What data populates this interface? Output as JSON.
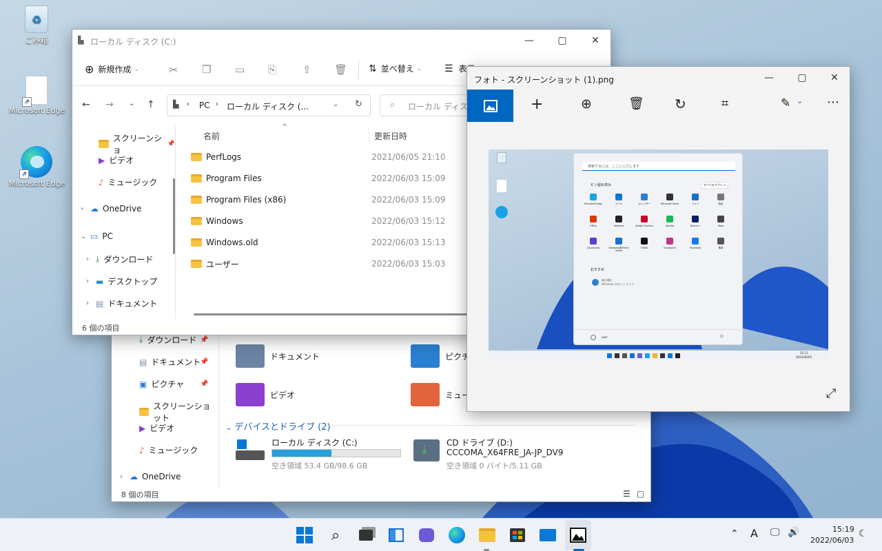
{
  "desktop": {
    "icons": [
      {
        "label": "ごみ箱"
      },
      {
        "label": "Microsoft Edge"
      },
      {
        "label": "Microsoft Edge"
      }
    ]
  },
  "back_explorer": {
    "sidebar": [
      "ダウンロード",
      "ドキュメント",
      "ピクチャ",
      "スクリーンショット",
      "ビデオ",
      "ミュージック",
      "OneDrive"
    ],
    "folders": [
      "ドキュメント",
      "ピクチャ",
      "ビデオ",
      "ミュー"
    ],
    "section_title": "デバイスとドライブ (2)",
    "drives": [
      {
        "name": "ローカル ディスク (C:)",
        "free": "空き領域 53.4 GB/98.6 GB",
        "used_fraction": 0.46
      },
      {
        "name": "CD ドライブ (D:)",
        "label": "CCCOMA_X64FRE_JA-JP_DV9",
        "free": "空き領域 0 バイト/5.11 GB"
      }
    ],
    "status": "8 個の項目"
  },
  "front_explorer": {
    "title": "ローカル ディスク (C:)",
    "new_label": "新規作成",
    "sort_label": "並べ替え",
    "view_label": "表示",
    "address": [
      "PC",
      "ローカル ディスク (..."
    ],
    "search_placeholder": "ローカル ディスク (C:)",
    "sidebar": [
      "スクリーンショ",
      "ビデオ",
      "ミュージック",
      "OneDrive",
      "PC",
      "ダウンロード",
      "デスクトップ",
      "ドキュメント"
    ],
    "columns": {
      "name": "名前",
      "date": "更新日時"
    },
    "rows": [
      {
        "name": "PerfLogs",
        "date": "2021/06/05 21:10"
      },
      {
        "name": "Program Files",
        "date": "2022/06/03 15:09"
      },
      {
        "name": "Program Files (x86)",
        "date": "2022/06/03 15:09"
      },
      {
        "name": "Windows",
        "date": "2022/06/03 15:12"
      },
      {
        "name": "Windows.old",
        "date": "2022/06/03 15:13"
      },
      {
        "name": "ユーザー",
        "date": "2022/06/03 15:03"
      }
    ],
    "status": "6 個の項目"
  },
  "photos": {
    "title": "フォト - スクリーンショット (1).png",
    "toolbar_icons": [
      "image-icon",
      "add-icon",
      "zoom-in-icon",
      "delete-icon",
      "rotate-icon",
      "crop-icon",
      "edit-icon",
      "more-icon"
    ],
    "thumb": {
      "search": "検索するには、ここに入力します",
      "pinned": "ピン留め済み",
      "all_apps": "すべてのアプリ >",
      "apps": [
        "Microsoft Edge",
        "メール",
        "カレンダー",
        "Microsoft Store",
        "フォト",
        "設定",
        "Office",
        "Solitaire",
        "Adobe Express",
        "Spotify",
        "Disney+",
        "Xbox",
        "Clipchamp",
        "Windows用Prime Video",
        "TikTok",
        "Instagram",
        "Facebook",
        "電卓"
      ],
      "recommended": "おすすめ",
      "rec_item": "はじめに",
      "rec_sub": "Windows のセットアップ",
      "user": "user",
      "time": "15:11",
      "date": "2022/06/03"
    }
  },
  "taskbar": {
    "time": "15:19",
    "date": "2022/06/03",
    "ime": "A"
  },
  "colors": {
    "accent": "#0067c0",
    "folder": "#f7c343",
    "drive_bar": "#26a0da"
  }
}
